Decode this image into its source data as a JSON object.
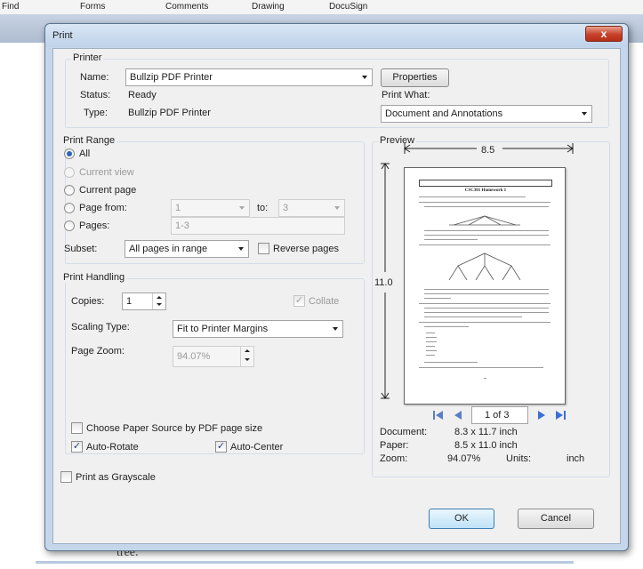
{
  "menubar": {
    "items": [
      "Find",
      "Forms",
      "Comments",
      "Drawing",
      "DocuSign"
    ]
  },
  "background": {
    "text": "tree."
  },
  "dialog": {
    "title": "Print",
    "close_glyph": "x",
    "printer": {
      "group_label": "Printer",
      "name_label": "Name:",
      "name_value": "Bullzip PDF Printer",
      "status_label": "Status:",
      "status_value": "Ready",
      "type_label": "Type:",
      "type_value": "Bullzip PDF Printer",
      "properties_button": "Properties",
      "print_what_label": "Print What:",
      "print_what_value": "Document and Annotations"
    },
    "print_range": {
      "group_label": "Print Range",
      "all": "All",
      "current_view": "Current view",
      "current_page": "Current page",
      "page_from": "Page from:",
      "from_value": "1",
      "to_label": "to:",
      "to_value": "3",
      "pages": "Pages:",
      "pages_value": "1-3",
      "subset_label": "Subset:",
      "subset_value": "All pages in range",
      "reverse_pages": "Reverse pages"
    },
    "print_handling": {
      "group_label": "Print Handling",
      "copies_label": "Copies:",
      "copies_value": "1",
      "collate": "Collate",
      "scaling_label": "Scaling Type:",
      "scaling_value": "Fit to Printer Margins",
      "zoom_label": "Page Zoom:",
      "zoom_value": "94.07%",
      "paper_source": "Choose Paper Source by PDF page size",
      "auto_rotate": "Auto-Rotate",
      "auto_center": "Auto-Center"
    },
    "grayscale": "Print as Grayscale",
    "preview": {
      "label": "Preview",
      "width_dim": "8.5",
      "height_dim": "11.0",
      "page_indicator": "1 of 3",
      "document_label": "Document:",
      "document_value": "8.3 x 11.7 inch",
      "paper_label": "Paper:",
      "paper_value": "8.5 x 11.0 inch",
      "zoom_label": "Zoom:",
      "zoom_value": "94.07%",
      "units_label": "Units:",
      "units_value": "inch",
      "page_title": "CSC301 Homework 1"
    },
    "ok_button": "OK",
    "cancel_button": "Cancel"
  }
}
